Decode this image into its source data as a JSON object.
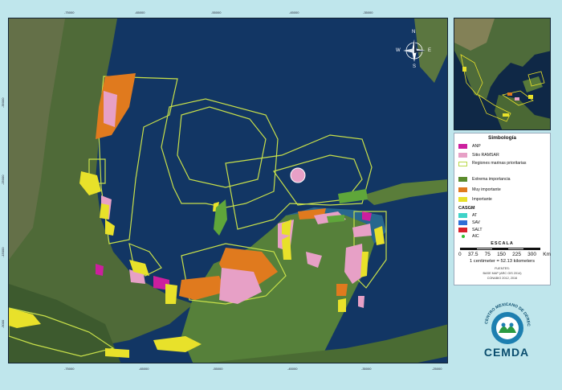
{
  "map": {
    "top_ticks": [
      "-75000",
      "-65000",
      "-55000",
      "-45000",
      "-35000",
      "-25000",
      "-15000",
      "-5000"
    ],
    "bottom_ticks": [
      "-75000",
      "-65000",
      "-55000",
      "-45000",
      "-35000",
      "-25000",
      "-15000",
      "-5000"
    ],
    "left_ticks": [
      "-35000",
      "-25000",
      "-15000",
      "-5000"
    ],
    "compass": {
      "n": "N",
      "s": "S",
      "e": "E",
      "w": "W"
    }
  },
  "legend": {
    "title": "Simbología",
    "items": [
      {
        "label": "ANP",
        "color": "#cc1f9e"
      },
      {
        "label": "Sitio RAMSAR",
        "color": "#e7a0c6"
      },
      {
        "label": "Regiones marinas prioritarias",
        "color": "#ffffff",
        "border": "#b9d84a"
      },
      {
        "label": "Extrema importancia",
        "color": "#5b8c2d"
      },
      {
        "label": "Muy importante",
        "color": "#e07a1e"
      },
      {
        "label": "Importante",
        "color": "#e8e12a"
      }
    ],
    "casgm_title": "CASGM",
    "casgm_items": [
      {
        "label": "AT",
        "color": "#3fd3c8"
      },
      {
        "label": "SAV",
        "color": "#2f6fd6"
      },
      {
        "label": "SALT",
        "color": "#d8222b"
      },
      {
        "label": "AIC",
        "color": "#30c030"
      }
    ],
    "scale": {
      "title": "ESCALA",
      "labels": [
        "0",
        "37.5",
        "75",
        "150",
        "225",
        "300"
      ],
      "unit": "Km",
      "equivalence": "1 centimeter = 52.13 kilometers",
      "source_1": "FUENTES:",
      "source_2": "BASE MAP (ARC GIS 2014)",
      "source_3": "CONABIO 2012, 2016"
    }
  },
  "logo": {
    "arc_text": "CENTRO MEXICANO DE DERECHO AMBIENTAL",
    "name": "CEMDA"
  }
}
